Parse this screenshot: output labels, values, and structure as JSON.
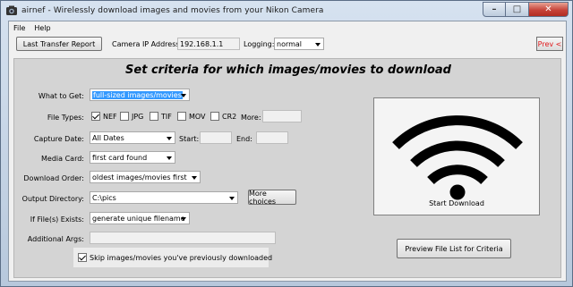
{
  "window": {
    "title": "airnef - Wirelessly download images and movies from your Nikon Camera",
    "min_glyph": "–",
    "max_glyph": "□",
    "close_glyph": "✕"
  },
  "menu": {
    "file": "File",
    "help": "Help"
  },
  "toolbar": {
    "last_transfer_label": "Last Transfer Report",
    "camera_ip_label": "Camera IP Address:",
    "camera_ip_value": "192.168.1.1",
    "logging_label": "Logging:",
    "logging_value": "normal",
    "prev_label": "Prev <"
  },
  "main": {
    "heading": "Set criteria for which images/movies to download",
    "what_to_get": {
      "label": "What to Get:",
      "value": "full-sized images/movies"
    },
    "file_types": {
      "label": "File Types:",
      "options": [
        {
          "label": "NEF",
          "checked": true
        },
        {
          "label": "JPG",
          "checked": false
        },
        {
          "label": "TIF",
          "checked": false
        },
        {
          "label": "MOV",
          "checked": false
        },
        {
          "label": "CR2",
          "checked": false
        }
      ],
      "more_label": "More:",
      "more_value": ""
    },
    "capture_date": {
      "label": "Capture Date:",
      "value": "All Dates",
      "start_label": "Start:",
      "start_value": "",
      "end_label": "End:",
      "end_value": ""
    },
    "media_card": {
      "label": "Media Card:",
      "value": "first card found"
    },
    "download_order": {
      "label": "Download Order:",
      "value": "oldest images/movies first"
    },
    "output_directory": {
      "label": "Output Directory:",
      "value": "C:\\pics",
      "more_choices_label": "More choices"
    },
    "if_exists": {
      "label": "If File(s) Exists:",
      "value": "generate unique filename"
    },
    "additional_args": {
      "label": "Additional Args:",
      "value": ""
    },
    "skip_previous": {
      "label": "Skip images/movies you've previously downloaded",
      "checked": true
    },
    "start_download_label": "Start Download",
    "preview_label": "Preview File List for Criteria"
  }
}
